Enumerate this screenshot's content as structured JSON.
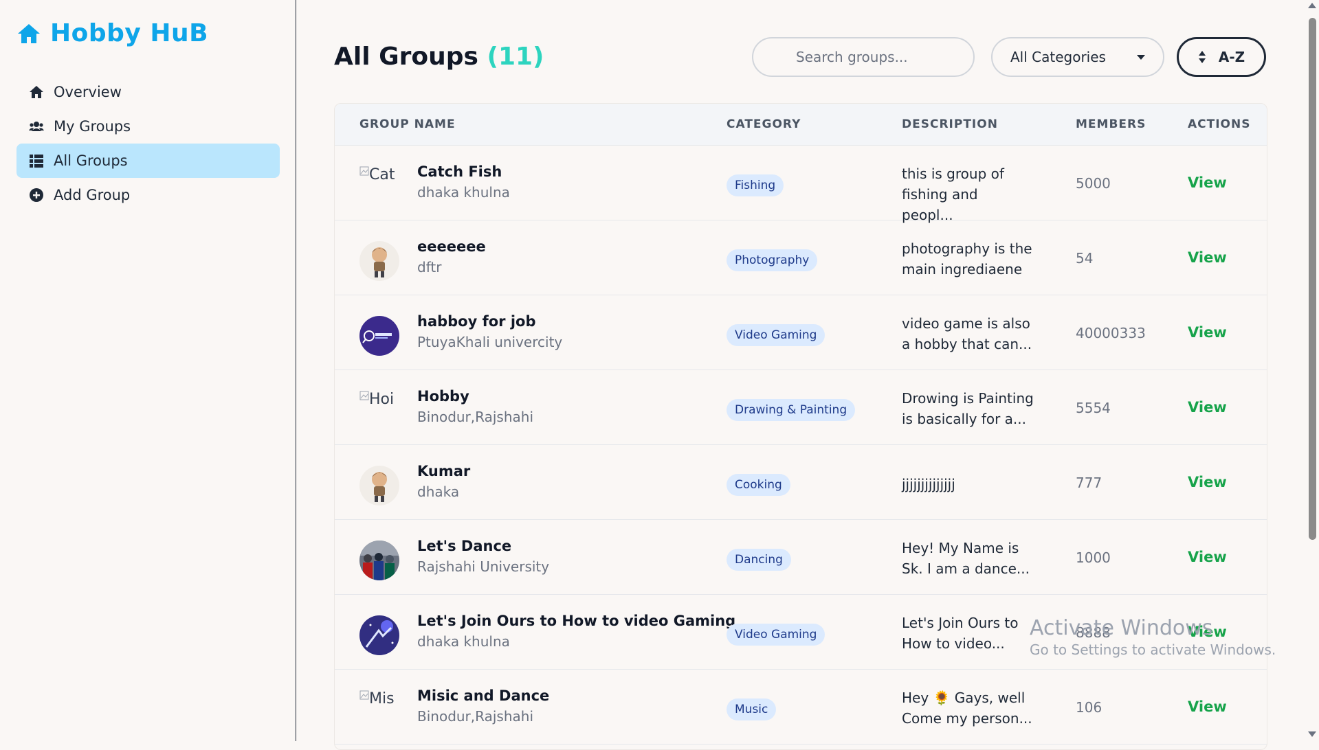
{
  "brand": {
    "name": "Hobby HuB",
    "color": "#0ea5e9"
  },
  "nav": [
    {
      "label": "Overview",
      "icon": "home-icon",
      "active": false
    },
    {
      "label": "My Groups",
      "icon": "users-icon",
      "active": false
    },
    {
      "label": "All Groups",
      "icon": "list-icon",
      "active": true
    },
    {
      "label": "Add Group",
      "icon": "plus-circle-icon",
      "active": false
    }
  ],
  "page": {
    "title": "All Groups",
    "count": "(11)"
  },
  "controls": {
    "search_placeholder": "Search groups...",
    "category_selected": "All Categories",
    "sort_label": "A-Z"
  },
  "table": {
    "headers": {
      "name": "GROUP NAME",
      "category": "CATEGORY",
      "description": "DESCRIPTION",
      "members": "MEMBERS",
      "actions": "ACTIONS"
    },
    "rows": [
      {
        "name": "Catch Fish",
        "location": "dhaka khulna",
        "category": "Fishing",
        "desc1": "this is group of",
        "desc2": "fishing and peopl...",
        "members": "5000",
        "action": "View",
        "avatar": "broken",
        "alt": "Cat"
      },
      {
        "name": "eeeeeee",
        "location": "dftr",
        "category": "Photography",
        "desc1": "photography is the",
        "desc2": "main ingrediaene",
        "members": "54",
        "action": "View",
        "avatar": "boy"
      },
      {
        "name": "habboy for job",
        "location": "PtuyaKhali univercity",
        "category": "Video Gaming",
        "desc1": "video game is also",
        "desc2": "a hobby that can...",
        "members": "40000333",
        "action": "View",
        "avatar": "jobtrack"
      },
      {
        "name": "Hobby",
        "location": "Binodur,Rajshahi",
        "category": "Drawing & Painting",
        "desc1": "Drowing is Painting",
        "desc2": "is basically for a...",
        "members": "5554",
        "action": "View",
        "avatar": "broken",
        "alt": "Hoi"
      },
      {
        "name": "Kumar",
        "location": "dhaka",
        "category": "Cooking",
        "desc1": "jjjjjjjjjjjjjj",
        "desc2": "",
        "members": "777",
        "action": "View",
        "avatar": "boy"
      },
      {
        "name": "Let's Dance",
        "location": "Rajshahi University",
        "category": "Dancing",
        "desc1": "Hey! My Name is",
        "desc2": "Sk. I am a dance...",
        "members": "1000",
        "action": "View",
        "avatar": "crowd"
      },
      {
        "name": "Let's Join Ours to How to video Gaming",
        "location": "dhaka khulna",
        "category": "Video Gaming",
        "desc1": "Let's Join Ours to",
        "desc2": "How to video...",
        "members": "8888",
        "action": "View",
        "avatar": "space"
      },
      {
        "name": "Misic and Dance",
        "location": "Binodur,Rajshahi",
        "category": "Music",
        "desc1": "Hey 🌻 Gays, well",
        "desc2": "Come my person...",
        "members": "106",
        "action": "View",
        "avatar": "broken",
        "alt": "Mis"
      }
    ]
  },
  "watermark": {
    "title": "Activate Windows",
    "subtitle": "Go to Settings to activate Windows."
  }
}
